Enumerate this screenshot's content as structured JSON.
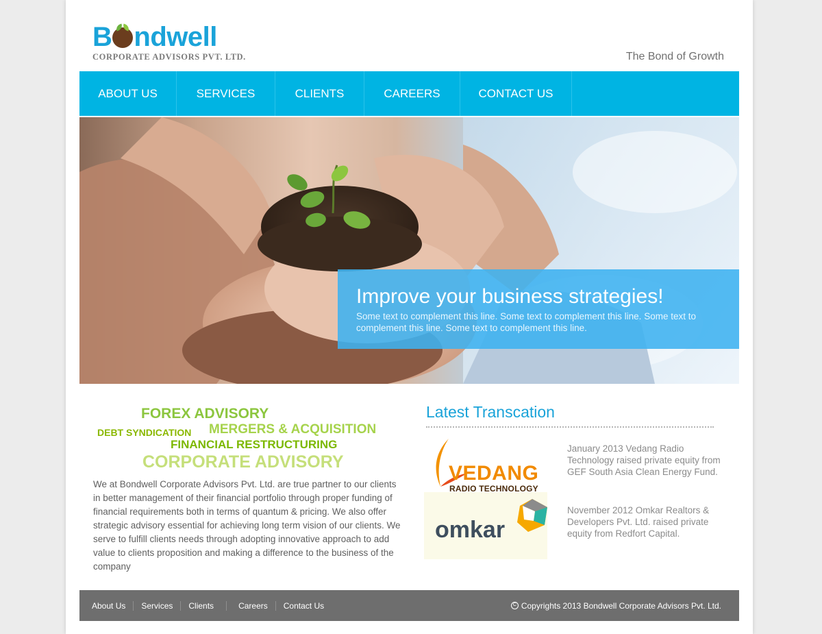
{
  "header": {
    "logo_word_start": "B",
    "logo_word_end": "ndwell",
    "logo_subtitle": "CORPORATE ADVISORS PVT. LTD.",
    "tagline": "The Bond of Growth"
  },
  "nav": {
    "items": [
      {
        "label": "ABOUT US"
      },
      {
        "label": "SERVICES"
      },
      {
        "label": "CLIENTS"
      },
      {
        "label": "CAREERS"
      },
      {
        "label": "CONTACT US"
      }
    ]
  },
  "hero": {
    "title": "Improve your business strategies!",
    "text": "Some text to complement this line. Some text to complement this line. Some text to complement this line. Some text to complement this line."
  },
  "services": {
    "forex": "FOREX ADVISORY",
    "debt": "DEBT SYNDICATION",
    "mergers": "MERGERS & ACQUISITION",
    "restructuring": "FINANCIAL RESTRUCTURING",
    "corporate": "CORPORATE ADVISORY"
  },
  "intro": {
    "paragraph": "We at Bondwell Corporate Advisors Pvt. Ltd.  are true  partner to our clients in better management of their financial portfolio through proper funding of financial requirements both in terms of quantum & pricing. We also offer strategic advisory essential for achieving long term vision of our clients.  We serve to fulfill clients needs  through adopting innovative approach to  add value to clients proposition and making a difference to the business of the   company"
  },
  "latest": {
    "title": "Latest Transcation",
    "transactions": [
      {
        "logo_word": "VEDANG",
        "logo_sub": "RADIO TECHNOLOGY",
        "text": "January 2013 Vedang Radio Technology raised private equity from GEF South Asia Clean Energy Fund."
      },
      {
        "logo_word": "omkar",
        "text": "November 2012 Omkar Realtors & Developers Pvt. Ltd. raised private equity from Redfort Capital."
      }
    ]
  },
  "footer": {
    "links": [
      {
        "label": "About Us"
      },
      {
        "label": "Services"
      },
      {
        "label": "Clients"
      },
      {
        "label": "Careers"
      },
      {
        "label": "Contact Us"
      }
    ],
    "copyright_symbol": "C",
    "copyright": "Copyrights 2013 Bondwell Corporate Advisors Pvt. Ltd."
  },
  "colors": {
    "brand_blue": "#00b4e3",
    "heading_blue": "#1aa3d9",
    "green": "#8cc63f",
    "footer_gray": "#6e6e6e"
  }
}
